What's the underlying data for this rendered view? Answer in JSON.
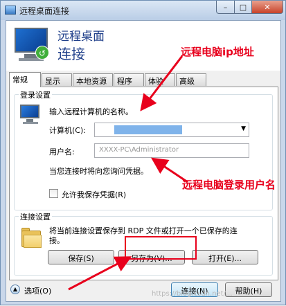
{
  "window": {
    "title": "远程桌面连接",
    "controls": {
      "minimize": "–",
      "maximize": "□",
      "close": "✕"
    }
  },
  "header": {
    "line1": "远程桌面",
    "line2": "连接"
  },
  "annotations": {
    "ip": "远程电脑ip地址",
    "user": "远程电脑登录用户名"
  },
  "tabs": [
    "常规",
    "显示",
    "本地资源",
    "程序",
    "体验",
    "高级"
  ],
  "login": {
    "legend": "登录设置",
    "prompt": "输入远程计算机的名称。",
    "computer_label": "计算机(C):",
    "username_label": "用户名:",
    "username_value": "XXXX-PC\\Administrator",
    "ask_text": "当您连接时将向您询问凭据。",
    "allow_save_label": "允许我保存凭据(R)"
  },
  "connection": {
    "legend": "连接设置",
    "description_line1": "将当前连接设置保存到 RDP 文件或打开一个已保存的连",
    "description_line2": "接。",
    "save_label": "保存(S)",
    "save_as_label": "另存为(V)...",
    "open_label": "打开(E)..."
  },
  "footer": {
    "options_label": "选项(O)",
    "connect_label": "连接(N)",
    "help_label": "帮助(H)",
    "watermark": "https://blog.csdn.net/..."
  },
  "colors": {
    "annotation": "#e8001c",
    "header_text": "#1f3f8a"
  }
}
